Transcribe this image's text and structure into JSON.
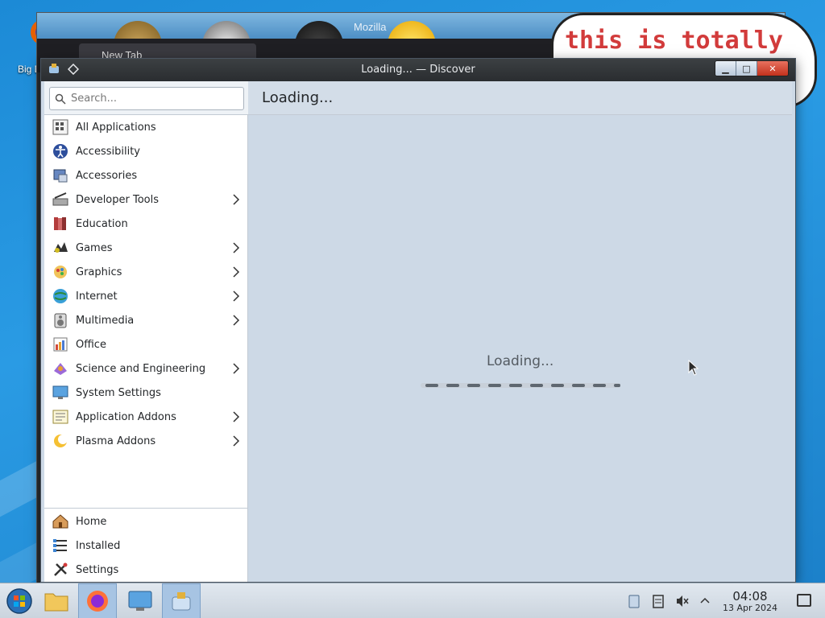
{
  "desktop": {
    "icon_label": "Big D",
    "bg_tab_title": "New Tab",
    "bg_mozilla_text": "Mozilla",
    "sketch_text": "this is totally"
  },
  "window": {
    "title": "Loading... — Discover",
    "minimize_label": "▁",
    "maximize_label": "□",
    "close_label": "✕"
  },
  "search": {
    "placeholder": "Search..."
  },
  "categories": [
    {
      "label": "All Applications",
      "icon": "all-applications-icon",
      "has_children": false
    },
    {
      "label": "Accessibility",
      "icon": "accessibility-icon",
      "has_children": false
    },
    {
      "label": "Accessories",
      "icon": "accessories-icon",
      "has_children": false
    },
    {
      "label": "Developer Tools",
      "icon": "developer-tools-icon",
      "has_children": true
    },
    {
      "label": "Education",
      "icon": "education-icon",
      "has_children": false
    },
    {
      "label": "Games",
      "icon": "games-icon",
      "has_children": true
    },
    {
      "label": "Graphics",
      "icon": "graphics-icon",
      "has_children": true
    },
    {
      "label": "Internet",
      "icon": "internet-icon",
      "has_children": true
    },
    {
      "label": "Multimedia",
      "icon": "multimedia-icon",
      "has_children": true
    },
    {
      "label": "Office",
      "icon": "office-icon",
      "has_children": false
    },
    {
      "label": "Science and Engineering",
      "icon": "science-icon",
      "has_children": true
    },
    {
      "label": "System Settings",
      "icon": "system-settings-icon",
      "has_children": false
    },
    {
      "label": "Application Addons",
      "icon": "application-addons-icon",
      "has_children": true
    },
    {
      "label": "Plasma Addons",
      "icon": "plasma-addons-icon",
      "has_children": true
    }
  ],
  "bottom_nav": [
    {
      "label": "Home",
      "icon": "home-icon"
    },
    {
      "label": "Installed",
      "icon": "installed-icon"
    },
    {
      "label": "Settings",
      "icon": "settings-icon"
    }
  ],
  "main": {
    "page_title": "Loading...",
    "loading_text": "Loading..."
  },
  "taskbar": {
    "clock_time": "04:08",
    "clock_date": "13 Apr 2024"
  },
  "colors": {
    "window_bg": "#cdd9e6",
    "titlebar": "#2a2d30",
    "close_button": "#c2311c",
    "taskbar_active": "#a7c4e3"
  }
}
